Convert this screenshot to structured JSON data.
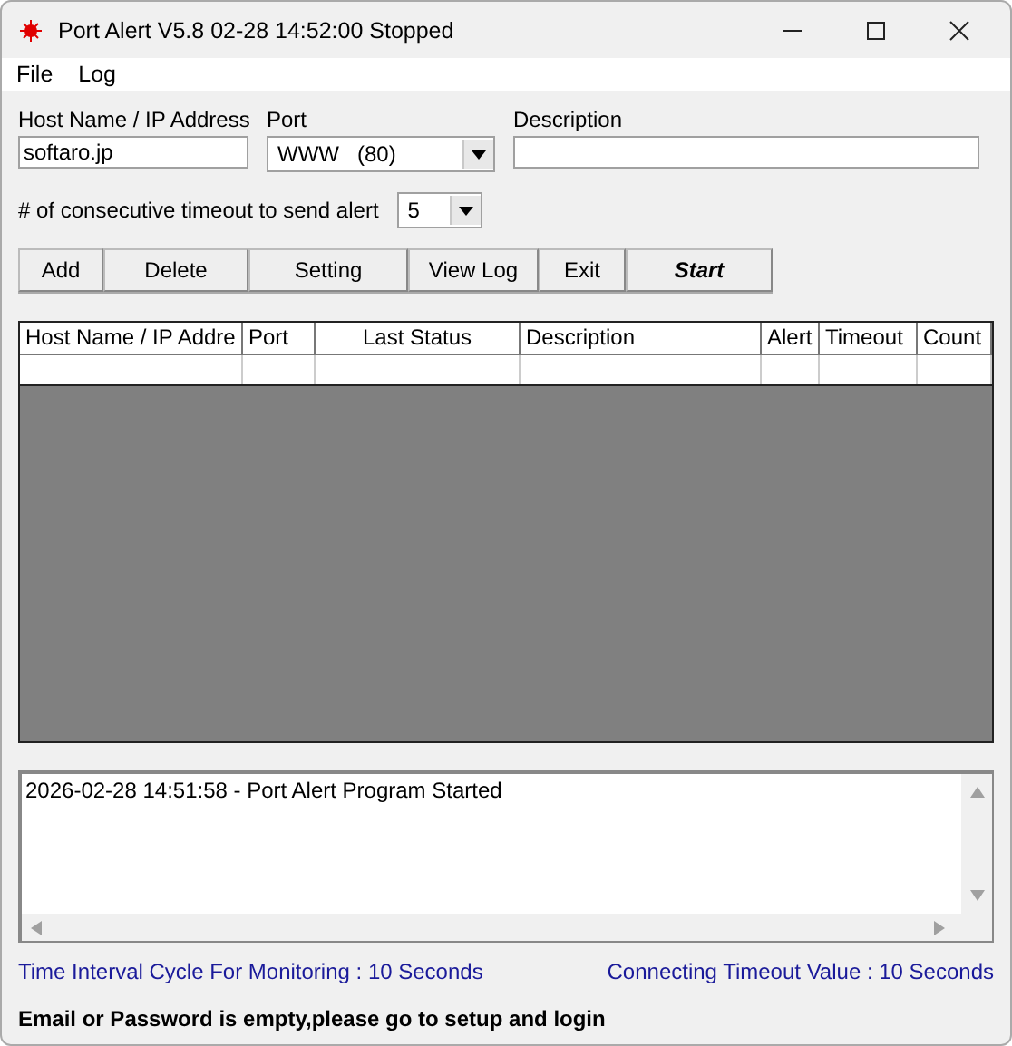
{
  "window": {
    "title": "Port Alert V5.8 02-28 14:52:00 Stopped"
  },
  "menu": [
    "File",
    "Log"
  ],
  "host": {
    "label": "Host Name / IP Address",
    "value": "softaro.jp"
  },
  "port": {
    "label": "Port",
    "value": "WWW   (80)"
  },
  "description": {
    "label": "Description"
  },
  "timeout_alert": {
    "label": "# of consecutive timeout to send alert",
    "value": "5"
  },
  "buttons": [
    {
      "label": "Add",
      "default": false
    },
    {
      "label": "Delete",
      "default": false
    },
    {
      "label": "Setting",
      "default": false
    },
    {
      "label": "View Log",
      "default": false
    },
    {
      "label": "Exit",
      "default": false
    },
    {
      "label": "Start",
      "default": true
    }
  ],
  "table": {
    "columns": [
      "Host Name / IP Addre",
      "Port",
      "Last Status",
      "Description",
      "Alert",
      "Timeout",
      "Count"
    ]
  },
  "log": [
    "2026-02-28 14:51:58 - Port Alert Program Started"
  ],
  "status": {
    "interval": "Time Interval Cycle For Monitoring : 10 Seconds",
    "timeout": "Connecting Timeout Value : 10 Seconds",
    "message": "Email or Password is empty,please go to setup and login"
  }
}
